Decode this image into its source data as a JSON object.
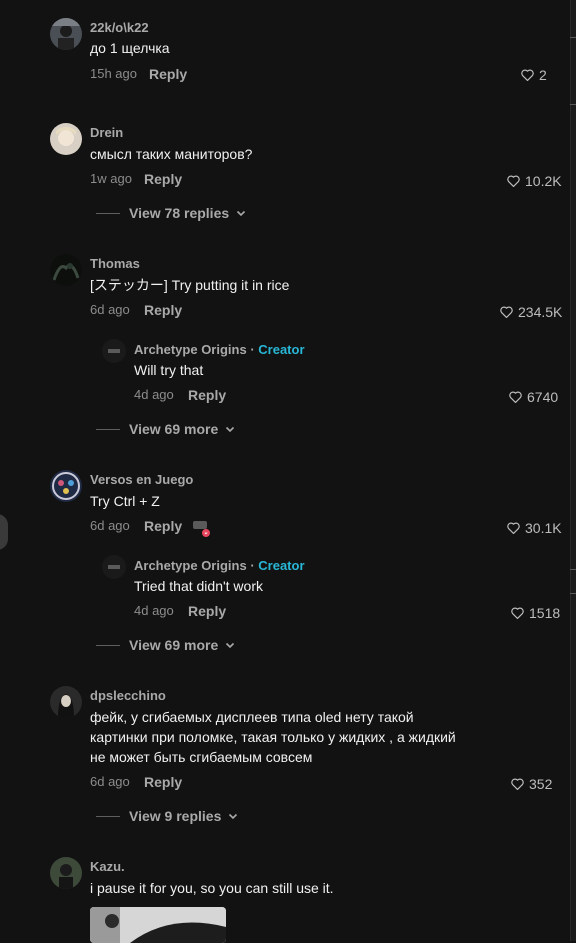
{
  "comments": [
    {
      "username": "22k/o\\k22",
      "text": "до 1 щелчка",
      "time": "15h ago",
      "reply_label": "Reply",
      "likes": "2",
      "avatar_icon": "user-avatar"
    },
    {
      "username": "Drein",
      "text": "смысл таких маниторов?",
      "time": "1w ago",
      "reply_label": "Reply",
      "likes": "10.2K",
      "view_more": "View 78 replies",
      "avatar_icon": "user-avatar"
    },
    {
      "username": "Thomas",
      "text": "[ステッカー] Try putting it in rice",
      "time": "6d ago",
      "reply_label": "Reply",
      "likes": "234.5K",
      "reply": {
        "username": "Archetype Origins",
        "separator": " · ",
        "creator_label": "Creator",
        "text": "Will try that",
        "time": "4d ago",
        "reply_label": "Reply",
        "likes": "6740"
      },
      "view_more": "View 69 more",
      "avatar_icon": "user-avatar"
    },
    {
      "username": "Versos en Juego",
      "text": "Try Ctrl + Z",
      "time": "6d ago",
      "reply_label": "Reply",
      "likes": "30.1K",
      "reply": {
        "username": "Archetype Origins",
        "separator": " · ",
        "creator_label": "Creator",
        "text": "Tried that didn't work",
        "time": "4d ago",
        "reply_label": "Reply",
        "likes": "1518"
      },
      "view_more": "View 69 more",
      "avatar_icon": "user-avatar"
    },
    {
      "username": "dpslecchino",
      "text_lines": [
        "фейк, у сгибаемых дисплеев типа oled нету такой",
        "картинки при поломке, такая только у жидких , а жидкий",
        "не может быть сгибаемым совсем"
      ],
      "time": "6d ago",
      "reply_label": "Reply",
      "likes": "352",
      "view_more": "View 9 replies",
      "avatar_icon": "user-avatar"
    },
    {
      "username": "Kazu.",
      "text": "i pause it for you, so you can still use it.",
      "avatar_icon": "user-avatar"
    }
  ],
  "colors": {
    "background": "#121212",
    "creator_accent": "#28b7d6",
    "muted_text": "#a9a9a9"
  },
  "icons": [
    "heart-icon",
    "chevron-down-icon",
    "sticker-icon",
    "image-thumbnail"
  ]
}
